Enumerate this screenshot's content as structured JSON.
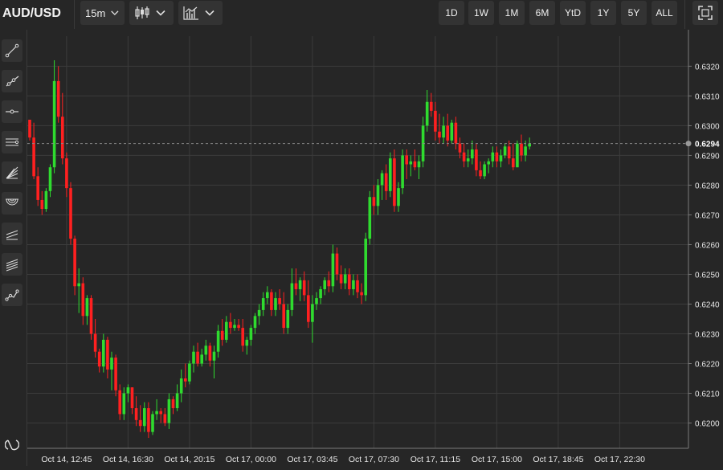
{
  "header": {
    "symbol": "AUD/USD",
    "interval": "15m",
    "chart_type_icon": "candlestick-icon",
    "indicators_icon": "indicators-icon",
    "timeframes": [
      "1D",
      "1W",
      "1M",
      "6M",
      "YtD",
      "1Y",
      "5Y",
      "ALL"
    ],
    "fullscreen_icon": "fullscreen-icon"
  },
  "drawing_tools": [
    "trend-line-icon",
    "ray-icon",
    "horizontal-line-icon",
    "parallel-channel-icon",
    "fib-fan-icon",
    "fib-arc-icon",
    "regression-channel-icon",
    "pitchfork-icon",
    "path-icon",
    "magnet-icon"
  ],
  "colors": {
    "up": "#2fdb2f",
    "down": "#ff2020",
    "background": "#262626",
    "grid": "#3c3c3c",
    "price_line": "#8a8a8a"
  },
  "current_price": "0.6294",
  "chart_data": {
    "type": "candlestick",
    "symbol": "AUD/USD",
    "y_ticks": [
      "0.6200",
      "0.6210",
      "0.6220",
      "0.6230",
      "0.6240",
      "0.6250",
      "0.6260",
      "0.6270",
      "0.6280",
      "0.6290",
      "0.6300",
      "0.6310",
      "0.6320"
    ],
    "ylim": [
      0.61915,
      0.63301
    ],
    "x_ticks": [
      "Oct 14, 12:45",
      "Oct 14, 16:30",
      "Oct 14, 20:15",
      "Oct 17, 00:00",
      "Oct 17, 03:45",
      "Oct 17, 07:30",
      "Oct 17, 11:15",
      "Oct 17, 15:00",
      "Oct 17, 18:45",
      "Oct 17, 22:30"
    ],
    "x_tick_bar_index": [
      9,
      24,
      39,
      54,
      69,
      84,
      99,
      114,
      129,
      144
    ],
    "grid": true,
    "candles": [
      [
        0.6302,
        0.6302,
        0.6295,
        0.6296
      ],
      [
        0.6296,
        0.6301,
        0.6282,
        0.6283
      ],
      [
        0.6283,
        0.6286,
        0.6273,
        0.6275
      ],
      [
        0.6275,
        0.6278,
        0.627,
        0.6272
      ],
      [
        0.6272,
        0.6279,
        0.6271,
        0.6278
      ],
      [
        0.6278,
        0.6287,
        0.6276,
        0.6286
      ],
      [
        0.6286,
        0.6322,
        0.6284,
        0.6315
      ],
      [
        0.6315,
        0.632,
        0.6301,
        0.6303
      ],
      [
        0.6303,
        0.6311,
        0.6287,
        0.6289
      ],
      [
        0.6289,
        0.6291,
        0.6276,
        0.6279
      ],
      [
        0.6279,
        0.6281,
        0.626,
        0.6262
      ],
      [
        0.6262,
        0.6263,
        0.6243,
        0.6246
      ],
      [
        0.6246,
        0.6252,
        0.6237,
        0.6247
      ],
      [
        0.6247,
        0.6249,
        0.6233,
        0.6236
      ],
      [
        0.6236,
        0.6243,
        0.6233,
        0.6242
      ],
      [
        0.6242,
        0.6243,
        0.6228,
        0.623
      ],
      [
        0.623,
        0.6235,
        0.6222,
        0.6224
      ],
      [
        0.6224,
        0.6225,
        0.6217,
        0.6219
      ],
      [
        0.6219,
        0.623,
        0.6217,
        0.6228
      ],
      [
        0.6228,
        0.6229,
        0.6215,
        0.6218
      ],
      [
        0.6218,
        0.6224,
        0.6211,
        0.6222
      ],
      [
        0.6222,
        0.6223,
        0.6209,
        0.6211
      ],
      [
        0.6211,
        0.6213,
        0.6201,
        0.6203
      ],
      [
        0.6203,
        0.6212,
        0.6201,
        0.621
      ],
      [
        0.621,
        0.6213,
        0.6207,
        0.6212
      ],
      [
        0.6212,
        0.6212,
        0.6203,
        0.6205
      ],
      [
        0.6205,
        0.6209,
        0.6199,
        0.6201
      ],
      [
        0.6201,
        0.6206,
        0.6197,
        0.6199
      ],
      [
        0.6199,
        0.6207,
        0.6197,
        0.6205
      ],
      [
        0.6205,
        0.6207,
        0.6195,
        0.6197
      ],
      [
        0.6197,
        0.6204,
        0.6196,
        0.6203
      ],
      [
        0.6203,
        0.6208,
        0.6201,
        0.6204
      ],
      [
        0.6204,
        0.6205,
        0.62,
        0.6203
      ],
      [
        0.6203,
        0.6205,
        0.6199,
        0.62
      ],
      [
        0.62,
        0.621,
        0.6198,
        0.6208
      ],
      [
        0.6208,
        0.6209,
        0.6203,
        0.6205
      ],
      [
        0.6205,
        0.6213,
        0.6204,
        0.621
      ],
      [
        0.621,
        0.6218,
        0.6207,
        0.6215
      ],
      [
        0.6215,
        0.622,
        0.6212,
        0.6214
      ],
      [
        0.6214,
        0.6221,
        0.6213,
        0.622
      ],
      [
        0.622,
        0.6226,
        0.6217,
        0.6224
      ],
      [
        0.6224,
        0.6227,
        0.6219,
        0.622
      ],
      [
        0.622,
        0.6225,
        0.6219,
        0.6223
      ],
      [
        0.6223,
        0.6228,
        0.6221,
        0.6226
      ],
      [
        0.6226,
        0.6227,
        0.6219,
        0.6221
      ],
      [
        0.6221,
        0.6226,
        0.6215,
        0.6224
      ],
      [
        0.6224,
        0.6233,
        0.6222,
        0.6231
      ],
      [
        0.6231,
        0.6235,
        0.6226,
        0.6228
      ],
      [
        0.6228,
        0.6236,
        0.6227,
        0.6234
      ],
      [
        0.6234,
        0.6237,
        0.623,
        0.6232
      ],
      [
        0.6232,
        0.6235,
        0.6231,
        0.6233
      ],
      [
        0.6233,
        0.6235,
        0.6231,
        0.6232
      ],
      [
        0.6232,
        0.6235,
        0.6224,
        0.6226
      ],
      [
        0.6226,
        0.6229,
        0.6223,
        0.6228
      ],
      [
        0.6228,
        0.6233,
        0.6226,
        0.6232
      ],
      [
        0.6232,
        0.6237,
        0.623,
        0.6236
      ],
      [
        0.6236,
        0.624,
        0.6233,
        0.6238
      ],
      [
        0.6238,
        0.6244,
        0.6236,
        0.6242
      ],
      [
        0.6242,
        0.6246,
        0.624,
        0.6244
      ],
      [
        0.6244,
        0.6245,
        0.6236,
        0.6238
      ],
      [
        0.6238,
        0.6244,
        0.6236,
        0.6242
      ],
      [
        0.6242,
        0.6245,
        0.6238,
        0.624
      ],
      [
        0.624,
        0.6244,
        0.623,
        0.6232
      ],
      [
        0.6232,
        0.624,
        0.623,
        0.6238
      ],
      [
        0.6238,
        0.6252,
        0.6236,
        0.6247
      ],
      [
        0.6247,
        0.6252,
        0.6243,
        0.6245
      ],
      [
        0.6245,
        0.6249,
        0.6241,
        0.6248
      ],
      [
        0.6248,
        0.6251,
        0.6241,
        0.6243
      ],
      [
        0.6243,
        0.6248,
        0.6232,
        0.6234
      ],
      [
        0.6234,
        0.6243,
        0.6227,
        0.624
      ],
      [
        0.624,
        0.6244,
        0.6238,
        0.6242
      ],
      [
        0.6242,
        0.6246,
        0.624,
        0.6245
      ],
      [
        0.6245,
        0.6249,
        0.6243,
        0.6248
      ],
      [
        0.6248,
        0.6251,
        0.6244,
        0.6246
      ],
      [
        0.6246,
        0.626,
        0.6244,
        0.6257
      ],
      [
        0.6257,
        0.6259,
        0.6248,
        0.625
      ],
      [
        0.625,
        0.6253,
        0.6245,
        0.6247
      ],
      [
        0.6247,
        0.6252,
        0.6245,
        0.625
      ],
      [
        0.625,
        0.6252,
        0.6243,
        0.6245
      ],
      [
        0.6245,
        0.625,
        0.6243,
        0.6248
      ],
      [
        0.6248,
        0.625,
        0.6242,
        0.6244
      ],
      [
        0.6244,
        0.6247,
        0.624,
        0.6243
      ],
      [
        0.6243,
        0.6264,
        0.6241,
        0.6262
      ],
      [
        0.6262,
        0.6278,
        0.626,
        0.6276
      ],
      [
        0.6276,
        0.628,
        0.627,
        0.6273
      ],
      [
        0.6273,
        0.6282,
        0.627,
        0.628
      ],
      [
        0.628,
        0.6285,
        0.6275,
        0.6284
      ],
      [
        0.6284,
        0.6287,
        0.6275,
        0.6278
      ],
      [
        0.6278,
        0.6291,
        0.6276,
        0.6289
      ],
      [
        0.6289,
        0.6292,
        0.6271,
        0.6273
      ],
      [
        0.6273,
        0.6281,
        0.6271,
        0.6279
      ],
      [
        0.6279,
        0.6292,
        0.6277,
        0.629
      ],
      [
        0.629,
        0.6292,
        0.6282,
        0.6287
      ],
      [
        0.6287,
        0.629,
        0.6283,
        0.6288
      ],
      [
        0.6288,
        0.6292,
        0.6285,
        0.6286
      ],
      [
        0.6286,
        0.629,
        0.6282,
        0.6288
      ],
      [
        0.6288,
        0.6303,
        0.6286,
        0.63
      ],
      [
        0.63,
        0.6312,
        0.6298,
        0.6308
      ],
      [
        0.6308,
        0.6311,
        0.6303,
        0.6305
      ],
      [
        0.6305,
        0.6308,
        0.6295,
        0.6298
      ],
      [
        0.6298,
        0.6304,
        0.6294,
        0.6296
      ],
      [
        0.6296,
        0.6303,
        0.6294,
        0.63
      ],
      [
        0.63,
        0.6304,
        0.6293,
        0.6295
      ],
      [
        0.6295,
        0.6302,
        0.6294,
        0.6301
      ],
      [
        0.6301,
        0.6303,
        0.6292,
        0.6294
      ],
      [
        0.6294,
        0.6296,
        0.6289,
        0.6291
      ],
      [
        0.6291,
        0.6294,
        0.6286,
        0.6288
      ],
      [
        0.6288,
        0.6292,
        0.6286,
        0.6289
      ],
      [
        0.6289,
        0.6295,
        0.6287,
        0.6292
      ],
      [
        0.6292,
        0.6294,
        0.6283,
        0.6285
      ],
      [
        0.6285,
        0.6288,
        0.6282,
        0.6283
      ],
      [
        0.6283,
        0.6288,
        0.6282,
        0.6287
      ],
      [
        0.6287,
        0.6289,
        0.6284,
        0.6288
      ],
      [
        0.6288,
        0.6293,
        0.6286,
        0.6291
      ],
      [
        0.6291,
        0.6293,
        0.6286,
        0.6288
      ],
      [
        0.6288,
        0.6292,
        0.6286,
        0.629
      ],
      [
        0.629,
        0.6294,
        0.6289,
        0.6293
      ],
      [
        0.6293,
        0.6295,
        0.6287,
        0.6289
      ],
      [
        0.6289,
        0.6294,
        0.6285,
        0.6286
      ],
      [
        0.6286,
        0.6295,
        0.6286,
        0.6294
      ],
      [
        0.6294,
        0.6297,
        0.6288,
        0.629
      ],
      [
        0.629,
        0.6295,
        0.6288,
        0.6293
      ],
      [
        0.6293,
        0.6296,
        0.6292,
        0.6294
      ]
    ]
  }
}
